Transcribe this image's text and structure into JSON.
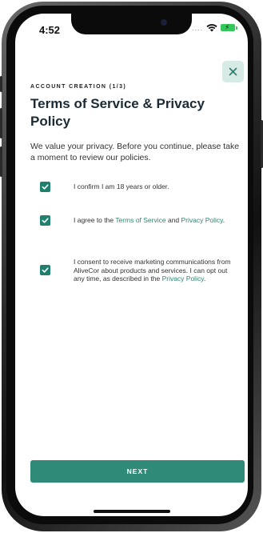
{
  "status_bar": {
    "time": "4:52",
    "signal_dots": "....",
    "wifi_icon": "wifi-icon",
    "battery_icon": "battery-charging-icon",
    "battery_color": "#34c759"
  },
  "header": {
    "close_icon": "close-icon",
    "step_label": "ACCOUNT CREATION (1/3)",
    "title": "Terms of Service & Privacy Policy",
    "intro": "We value your privacy. Before you continue, please take a moment to review our policies."
  },
  "consents": [
    {
      "checked": true,
      "text": "I confirm I am 18 years or older."
    },
    {
      "checked": true,
      "text_before": "I agree to the ",
      "link1": "Terms of Service",
      "text_middle": " and ",
      "link2": "Privacy Policy",
      "text_after": "."
    },
    {
      "checked": true,
      "text_before": "I consent to receive marketing communications from AliveCor about products and services. I can opt out any time, as described in the ",
      "link1": "Privacy Policy",
      "text_after": "."
    }
  ],
  "footer": {
    "next_label": "NEXT"
  },
  "colors": {
    "accent": "#2f8a78",
    "checkbox": "#237f6d",
    "link": "#2a8574",
    "close_bg": "#d6ebe6",
    "title": "#1b2a35"
  }
}
